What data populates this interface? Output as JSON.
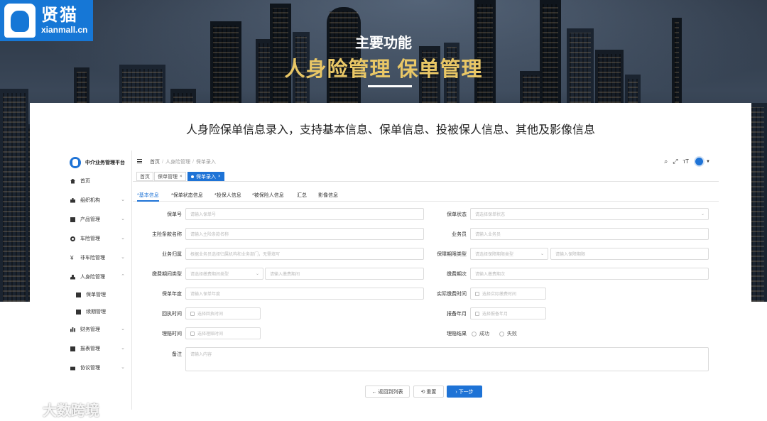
{
  "logo": {
    "cn": "贤猫",
    "en": "xianmall.cn"
  },
  "headline": {
    "sub": "主要功能",
    "main": "人身险管理 保单管理"
  },
  "caption": "人身险保单信息录入，支持基本信息、保单信息、投被保人信息、其他及影像信息",
  "app": {
    "brand": "中介业务管理平台",
    "menu": [
      {
        "label": "首页",
        "icon": "home-icon",
        "chevron": false
      },
      {
        "label": "组织机构",
        "icon": "org-icon",
        "chevron": true
      },
      {
        "label": "产品管理",
        "icon": "product-icon",
        "chevron": true
      },
      {
        "label": "车险管理",
        "icon": "car-insurance-icon",
        "chevron": true
      },
      {
        "label": "非车险管理",
        "icon": "yen-icon",
        "chevron": true
      },
      {
        "label": "人身险管理",
        "icon": "person-icon",
        "chevron": true
      },
      {
        "label": "保单管理",
        "icon": "document-icon",
        "chevron": false,
        "sub": true
      },
      {
        "label": "续期管理",
        "icon": "document-icon",
        "chevron": false,
        "sub": true
      },
      {
        "label": "财务管理",
        "icon": "bar-chart-icon",
        "chevron": true
      },
      {
        "label": "报表管理",
        "icon": "report-icon",
        "chevron": true
      },
      {
        "label": "协议管理",
        "icon": "agreement-icon",
        "chevron": true
      }
    ],
    "breadcrumb": [
      "首页",
      "人身险管理",
      "保单录入"
    ],
    "page_tabs": [
      {
        "label": "首页",
        "closable": false,
        "active": false
      },
      {
        "label": "保单管理",
        "closable": true,
        "active": false
      },
      {
        "label": "保单录入",
        "closable": true,
        "active": true
      }
    ],
    "sub_tabs": [
      "*基本信息",
      "*保单状态信息",
      "*投保人信息",
      "*被保险人信息",
      "汇总",
      "影像信息"
    ],
    "form": {
      "policy_no": {
        "label": "保单号",
        "placeholder": "请输入保单号"
      },
      "policy_status": {
        "label": "保单状态",
        "placeholder": "请选择保单状态"
      },
      "main_clause": {
        "label": "主险条款名称",
        "placeholder": "请输入主险条款名称"
      },
      "salesman": {
        "label": "业务员",
        "placeholder": "请输入业务员"
      },
      "business_owner": {
        "label": "业务归属",
        "placeholder": "根据业务员选择归属机构和业务部门，无需填写"
      },
      "coverage_type": {
        "label": "保障期限类型",
        "placeholder": "请选择保障期限类型",
        "placeholder2": "请输入保障期限"
      },
      "payment_type": {
        "label": "缴费期间类型",
        "placeholder": "请选择缴费期间类型",
        "placeholder2": "请输入缴费期间"
      },
      "payment_count": {
        "label": "缴费期次",
        "placeholder": "请输入缴费期次"
      },
      "policy_year": {
        "label": "保单年度",
        "placeholder": "请输入保单年度"
      },
      "actual_pay_time": {
        "label": "实际缴费时间",
        "placeholder": "选择实际缴费时间"
      },
      "receipt_time": {
        "label": "回执时间",
        "placeholder": "选择回执时间"
      },
      "report_month": {
        "label": "报备年月",
        "placeholder": "选择报备年月"
      },
      "claim_time": {
        "label": "理赔时间",
        "placeholder": "选择理赔时间"
      },
      "claim_result": {
        "label": "理赔结果",
        "options": [
          "成功",
          "失败"
        ]
      },
      "remark": {
        "label": "备注",
        "placeholder": "请输入内容"
      }
    },
    "buttons": {
      "back": "← 返回到列表",
      "reset": "⟲ 重置",
      "next": "› 下一步"
    }
  },
  "watermark": "大数跨境"
}
